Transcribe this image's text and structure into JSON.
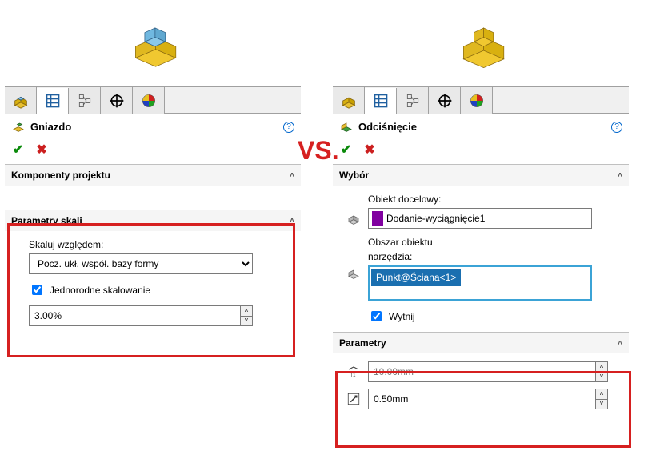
{
  "vs_label": "VS.",
  "left": {
    "title": "Gniazdo",
    "sections": {
      "components": {
        "title": "Komponenty projektu"
      },
      "scale": {
        "title": "Parametry skali",
        "about_label": "Skaluj względem:",
        "about_value": "Pocz. ukł. współ. bazy formy",
        "uniform_label": "Jednorodne skalowanie",
        "uniform_checked": true,
        "scale_value": "3.00%"
      }
    }
  },
  "right": {
    "title": "Odciśnięcie",
    "sections": {
      "selection": {
        "title": "Wybór",
        "target_label": "Obiekt docelowy:",
        "target_value": "Dodanie-wyciągnięcie1",
        "region_label_line1": "Obszar obiektu",
        "region_label_line2": "narzędzia:",
        "region_value": "Punkt@Ściana<1>",
        "cut_label": "Wytnij",
        "cut_checked": true
      },
      "params": {
        "title": "Parametry",
        "offset_value": "10.00mm",
        "clearance_value": "0.50mm"
      }
    }
  }
}
